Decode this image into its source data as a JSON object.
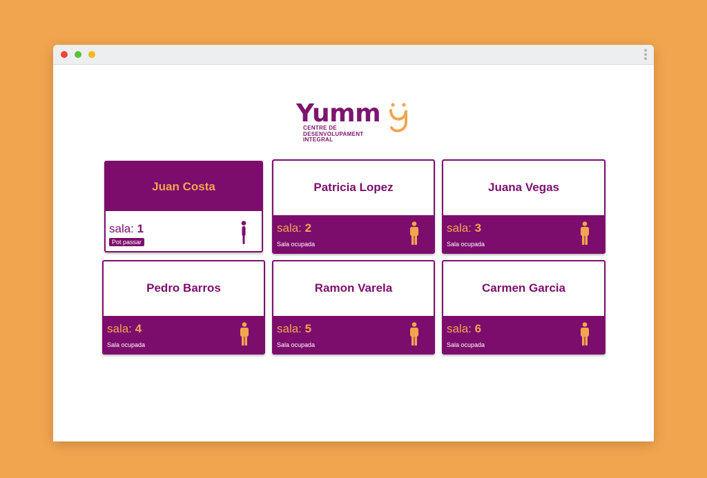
{
  "logo": {
    "word": "Yumm",
    "subtitle_lines": [
      "CENTRE DE",
      "DESENVOLUPAMENT",
      "INTEGRAL"
    ]
  },
  "colors": {
    "brand_purple": "#7d0d6d",
    "accent_orange": "#f2a54f",
    "background": "#f2a54f"
  },
  "room_prefix": "sala: ",
  "cards": [
    {
      "name": "Juan Costa",
      "room": "1",
      "status": "Pot passar",
      "state": "available"
    },
    {
      "name": "Patricia Lopez",
      "room": "2",
      "status": "Sala ocupada",
      "state": "occupied"
    },
    {
      "name": "Juana Vegas",
      "room": "3",
      "status": "Sala ocupada",
      "state": "occupied"
    },
    {
      "name": "Pedro Barros",
      "room": "4",
      "status": "Sala ocupada",
      "state": "occupied"
    },
    {
      "name": "Ramon Varela",
      "room": "5",
      "status": "Sala ocupada",
      "state": "occupied"
    },
    {
      "name": "Carmen Garcia",
      "room": "6",
      "status": "Sala ocupada",
      "state": "occupied"
    }
  ]
}
